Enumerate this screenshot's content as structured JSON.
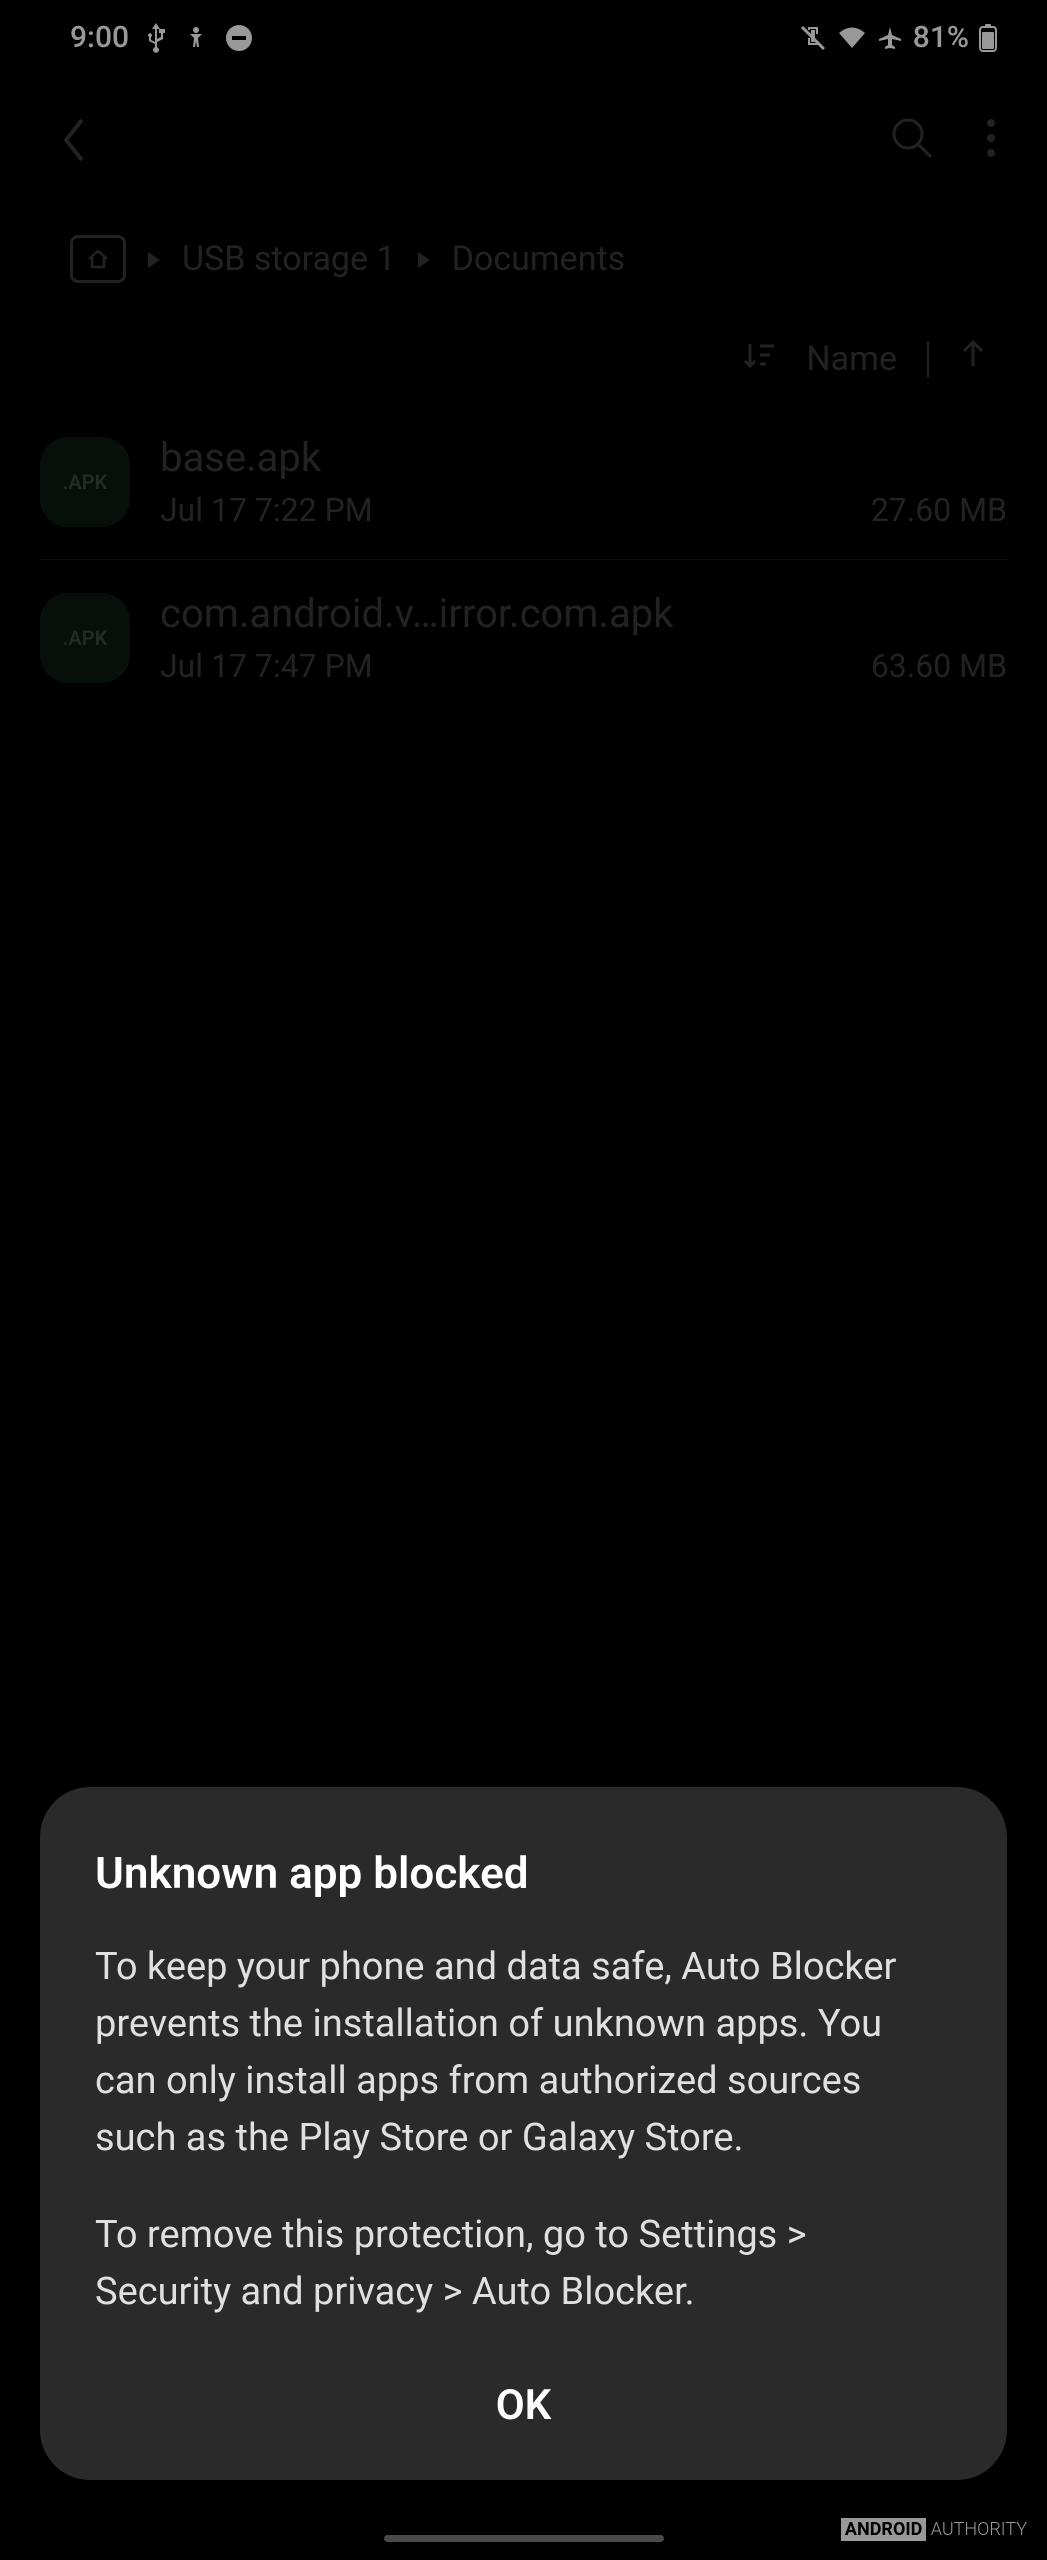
{
  "status": {
    "time": "9:00",
    "battery_text": "81%"
  },
  "breadcrumb": {
    "items": [
      "USB storage 1",
      "Documents"
    ]
  },
  "sort": {
    "label": "Name"
  },
  "files": [
    {
      "badge": ".APK",
      "name": "base.apk",
      "date": "Jul 17 7:22 PM",
      "size": "27.60 MB"
    },
    {
      "badge": ".APK",
      "name": "com.android.v…irror.com.apk",
      "date": "Jul 17 7:47 PM",
      "size": "63.60 MB"
    }
  ],
  "dialog": {
    "title": "Unknown app blocked",
    "body1": "To keep your phone and data safe, Auto Blocker prevents the installation of unknown apps. You can only install apps from authorized sources such as the Play Store or Galaxy Store.",
    "body2": "To remove this protection, go to Settings > Security and privacy > Auto Blocker.",
    "ok": "OK"
  },
  "watermark": {
    "brand": "ANDROID",
    "suffix": " AUTHORITY"
  }
}
